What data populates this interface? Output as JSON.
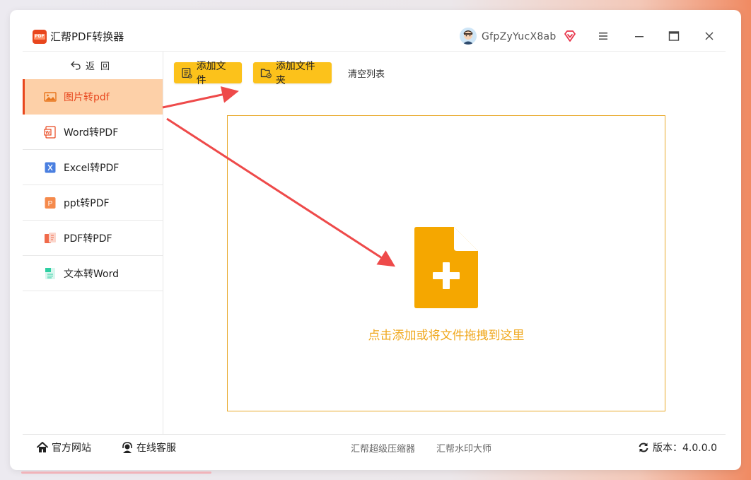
{
  "app": {
    "title": "汇帮PDF转换器",
    "logo_text": "PDF"
  },
  "user": {
    "name": "GfpZyYucX8ab"
  },
  "sidebar": {
    "back_label": "返回",
    "items": [
      {
        "label": "图片转pdf",
        "icon": "image-icon",
        "active": true
      },
      {
        "label": "Word转PDF",
        "icon": "word-icon"
      },
      {
        "label": "Excel转PDF",
        "icon": "excel-icon"
      },
      {
        "label": "ppt转PDF",
        "icon": "ppt-icon"
      },
      {
        "label": "PDF转PDF",
        "icon": "pdf-icon"
      },
      {
        "label": "文本转Word",
        "icon": "text-icon"
      }
    ]
  },
  "toolbar": {
    "add_file": "添加文件",
    "add_folder": "添加文件夹",
    "clear_list": "清空列表"
  },
  "dropzone": {
    "hint": "点击添加或将文件拖拽到这里"
  },
  "footer": {
    "official_site": "官方网站",
    "online_service": "在线客服",
    "compressor": "汇帮超级压缩器",
    "watermark": "汇帮水印大师",
    "version": "版本：4.0.0.0"
  },
  "colors": {
    "accent": "#e8461d",
    "button": "#fcc21b",
    "drop_icon": "#f5a700",
    "active_bg": "#fdd0a8",
    "arrow": "#ee4a4a"
  }
}
